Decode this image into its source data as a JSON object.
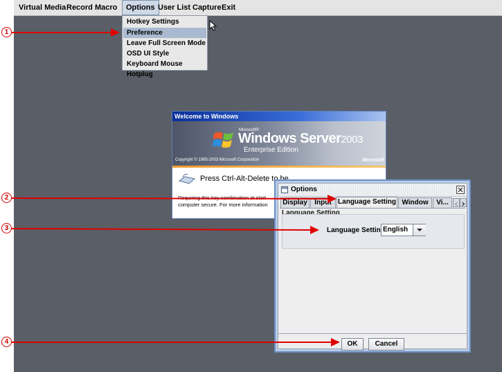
{
  "menubar": {
    "items": [
      "Virtual Media",
      "Record",
      "Macro",
      "Options",
      "User List",
      "Capture",
      "Exit"
    ],
    "active": "Options"
  },
  "options_menu": {
    "items": [
      "Hotkey Settings",
      "Preference",
      "Leave Full Screen Mode",
      "OSD UI Style",
      "Keyboard Mouse Hotplug"
    ],
    "selected": "Preference"
  },
  "welcome": {
    "title": "Welcome to Windows",
    "brand_small": "Microsoft®",
    "product": "Windows Server",
    "year": "2003",
    "edition": "Enterprise Edition",
    "copyright": "Copyright © 1985-2003  Microsoft Corporation",
    "ms_logo": "Microsoft",
    "prompt": "Press Ctrl-Alt-Delete to be",
    "body_line1": "Requiring this key combination at start",
    "body_line2": "computer secure. For more information"
  },
  "options_dialog": {
    "title": "Options",
    "tabs": [
      "Display",
      "Input",
      "Language Setting",
      "Window",
      "Vi..."
    ],
    "active_tab": "Language Setting",
    "group_title": "Language Setting",
    "field_label": "Language Setting",
    "field_value": "English",
    "ok_label": "OK",
    "cancel_label": "Cancel"
  },
  "callouts": [
    "1",
    "2",
    "3",
    "4"
  ],
  "colors": {
    "desktop": "#5a5e66",
    "callout_red": "#e00000",
    "dialog_border": "#6a8fc6"
  }
}
